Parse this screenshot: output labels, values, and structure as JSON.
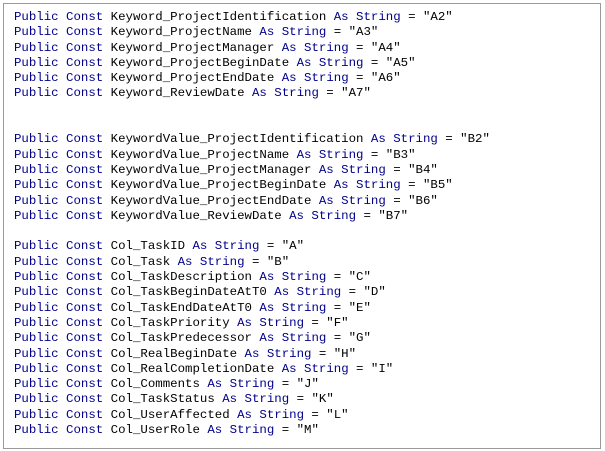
{
  "editor": {
    "colors": {
      "keyword": "#00008b",
      "text": "#000000",
      "border": "#9a9a9a",
      "background": "#ffffff"
    },
    "lines": [
      [
        {
          "t": "Public Const",
          "k": true
        },
        {
          "t": " Keyword_ProjectIdentification "
        },
        {
          "t": "As String",
          "k": true
        },
        {
          "t": " = \"A2\""
        }
      ],
      [
        {
          "t": "Public Const",
          "k": true
        },
        {
          "t": " Keyword_ProjectName "
        },
        {
          "t": "As String",
          "k": true
        },
        {
          "t": " = \"A3\""
        }
      ],
      [
        {
          "t": "Public Const",
          "k": true
        },
        {
          "t": " Keyword_ProjectManager "
        },
        {
          "t": "As String",
          "k": true
        },
        {
          "t": " = \"A4\""
        }
      ],
      [
        {
          "t": "Public Const",
          "k": true
        },
        {
          "t": " Keyword_ProjectBeginDate "
        },
        {
          "t": "As String",
          "k": true
        },
        {
          "t": " = \"A5\""
        }
      ],
      [
        {
          "t": "Public Const",
          "k": true
        },
        {
          "t": " Keyword_ProjectEndDate "
        },
        {
          "t": "As String",
          "k": true
        },
        {
          "t": " = \"A6\""
        }
      ],
      [
        {
          "t": "Public Const",
          "k": true
        },
        {
          "t": " Keyword_ReviewDate "
        },
        {
          "t": "As String",
          "k": true
        },
        {
          "t": " = \"A7\""
        }
      ],
      [],
      [],
      [
        {
          "t": "Public Const",
          "k": true
        },
        {
          "t": " KeywordValue_ProjectIdentification "
        },
        {
          "t": "As String",
          "k": true
        },
        {
          "t": " = \"B2\""
        }
      ],
      [
        {
          "t": "Public Const",
          "k": true
        },
        {
          "t": " KeywordValue_ProjectName "
        },
        {
          "t": "As String",
          "k": true
        },
        {
          "t": " = \"B3\""
        }
      ],
      [
        {
          "t": "Public Const",
          "k": true
        },
        {
          "t": " KeywordValue_ProjectManager "
        },
        {
          "t": "As String",
          "k": true
        },
        {
          "t": " = \"B4\""
        }
      ],
      [
        {
          "t": "Public Const",
          "k": true
        },
        {
          "t": " KeywordValue_ProjectBeginDate "
        },
        {
          "t": "As String",
          "k": true
        },
        {
          "t": " = \"B5\""
        }
      ],
      [
        {
          "t": "Public Const",
          "k": true
        },
        {
          "t": " KeywordValue_ProjectEndDate "
        },
        {
          "t": "As String",
          "k": true
        },
        {
          "t": " = \"B6\""
        }
      ],
      [
        {
          "t": "Public Const",
          "k": true
        },
        {
          "t": " KeywordValue_ReviewDate "
        },
        {
          "t": "As String",
          "k": true
        },
        {
          "t": " = \"B7\""
        }
      ],
      [],
      [
        {
          "t": "Public Const",
          "k": true
        },
        {
          "t": " Col_TaskID "
        },
        {
          "t": "As String",
          "k": true
        },
        {
          "t": " = \"A\""
        }
      ],
      [
        {
          "t": "Public Const",
          "k": true
        },
        {
          "t": " Col_Task "
        },
        {
          "t": "As String",
          "k": true
        },
        {
          "t": " = \"B\""
        }
      ],
      [
        {
          "t": "Public Const",
          "k": true
        },
        {
          "t": " Col_TaskDescription "
        },
        {
          "t": "As String",
          "k": true
        },
        {
          "t": " = \"C\""
        }
      ],
      [
        {
          "t": "Public Const",
          "k": true
        },
        {
          "t": " Col_TaskBeginDateAtT0 "
        },
        {
          "t": "As String",
          "k": true
        },
        {
          "t": " = \"D\""
        }
      ],
      [
        {
          "t": "Public Const",
          "k": true
        },
        {
          "t": " Col_TaskEndDateAtT0 "
        },
        {
          "t": "As String",
          "k": true
        },
        {
          "t": " = \"E\""
        }
      ],
      [
        {
          "t": "Public Const",
          "k": true
        },
        {
          "t": " Col_TaskPriority "
        },
        {
          "t": "As String",
          "k": true
        },
        {
          "t": " = \"F\""
        }
      ],
      [
        {
          "t": "Public Const",
          "k": true
        },
        {
          "t": " Col_TaskPredecessor "
        },
        {
          "t": "As String",
          "k": true
        },
        {
          "t": " = \"G\""
        }
      ],
      [
        {
          "t": "Public Const",
          "k": true
        },
        {
          "t": " Col_RealBeginDate "
        },
        {
          "t": "As String",
          "k": true
        },
        {
          "t": " = \"H\""
        }
      ],
      [
        {
          "t": "Public Const",
          "k": true
        },
        {
          "t": " Col_RealCompletionDate "
        },
        {
          "t": "As String",
          "k": true
        },
        {
          "t": " = \"I\""
        }
      ],
      [
        {
          "t": "Public Const",
          "k": true
        },
        {
          "t": " Col_Comments "
        },
        {
          "t": "As String",
          "k": true
        },
        {
          "t": " = \"J\""
        }
      ],
      [
        {
          "t": "Public Const",
          "k": true
        },
        {
          "t": " Col_TaskStatus "
        },
        {
          "t": "As String",
          "k": true
        },
        {
          "t": " = \"K\""
        }
      ],
      [
        {
          "t": "Public Const",
          "k": true
        },
        {
          "t": " Col_UserAffected "
        },
        {
          "t": "As String",
          "k": true
        },
        {
          "t": " = \"L\""
        }
      ],
      [
        {
          "t": "Public Const",
          "k": true
        },
        {
          "t": " Col_UserRole "
        },
        {
          "t": "As String",
          "k": true
        },
        {
          "t": " = \"M\""
        }
      ]
    ]
  }
}
